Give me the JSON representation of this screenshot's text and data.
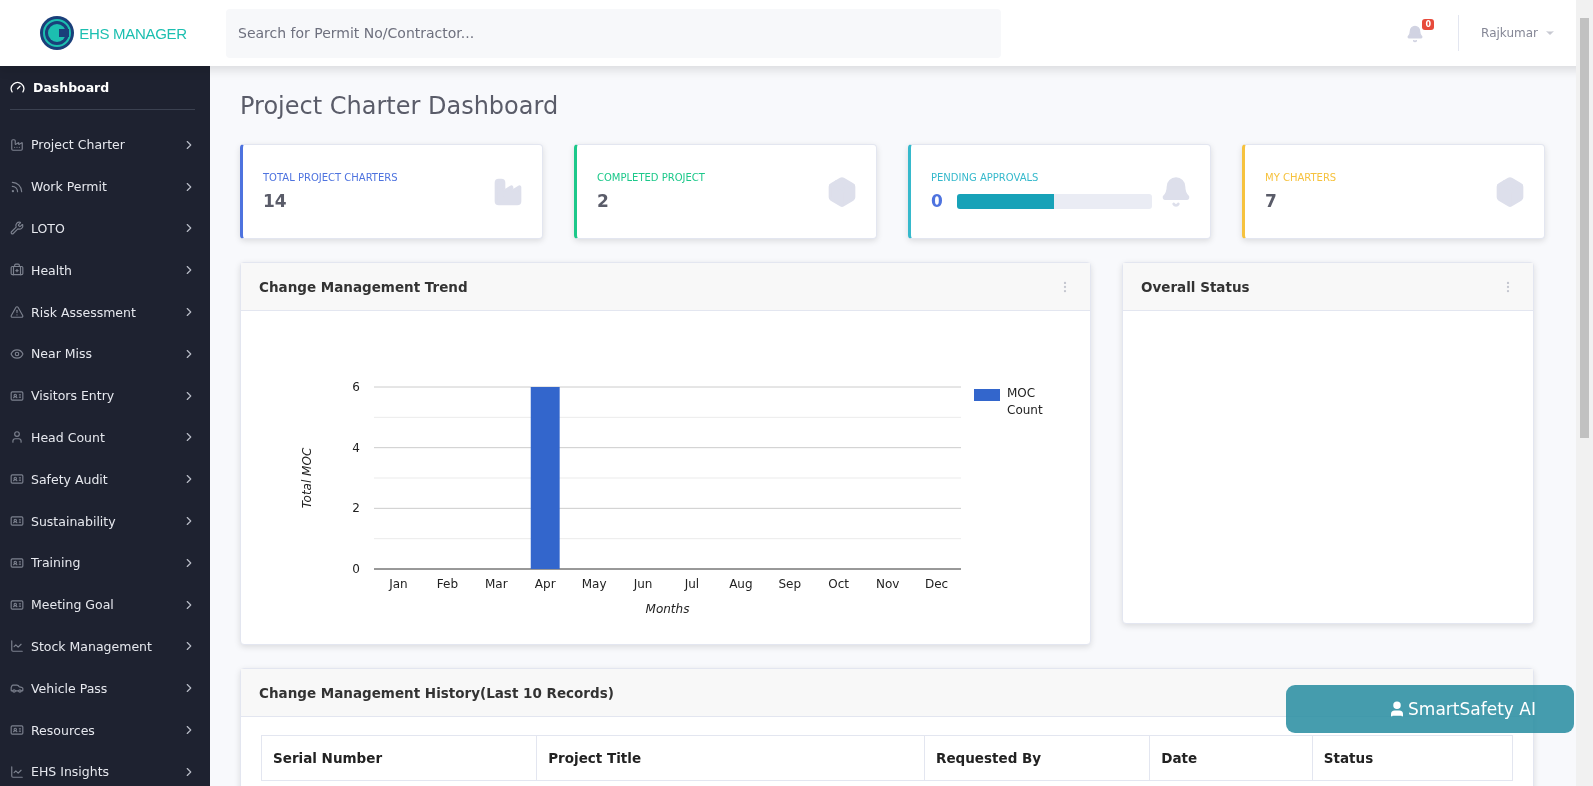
{
  "brand": {
    "name": "EHS MANAGER"
  },
  "search": {
    "placeholder": "Search for Permit No/Contractor..."
  },
  "notifications": {
    "count": "0"
  },
  "user": {
    "name": "Rajkumar"
  },
  "sidebar": {
    "header": {
      "label": "Dashboard",
      "selected": true
    },
    "items": [
      {
        "label": "Project Charter",
        "selected": false
      },
      {
        "label": "Work Permit",
        "selected": false
      },
      {
        "label": "LOTO",
        "selected": false
      },
      {
        "label": "Health",
        "selected": false
      },
      {
        "label": "Risk Assessment",
        "selected": false
      },
      {
        "label": "Near Miss",
        "selected": false
      },
      {
        "label": "Visitors Entry",
        "selected": false
      },
      {
        "label": "Head Count",
        "selected": false
      },
      {
        "label": "Safety Audit",
        "selected": false
      },
      {
        "label": "Sustainability",
        "selected": false
      },
      {
        "label": "Training",
        "selected": false
      },
      {
        "label": "Meeting Goal",
        "selected": false
      },
      {
        "label": "Stock Management",
        "selected": false
      },
      {
        "label": "Vehicle Pass",
        "selected": false
      },
      {
        "label": "Resources",
        "selected": false
      },
      {
        "label": "EHS Insights",
        "selected": false
      }
    ]
  },
  "page_title": "Project Charter Dashboard",
  "stat_cards": [
    {
      "label": "TOTAL PROJECT CHARTERS",
      "value": "14",
      "color": "#4e73df",
      "kind": "plain"
    },
    {
      "label": "COMPLETED PROJECT",
      "value": "2",
      "color": "#1cc88a",
      "kind": "plain"
    },
    {
      "label": "PENDING APPROVALS",
      "value": "0",
      "color": "#36b9cc",
      "kind": "progress",
      "level": 0.5
    },
    {
      "label": "MY CHARTERS",
      "value": "7",
      "color": "#f6c23e",
      "kind": "plain"
    }
  ],
  "trend_panel": {
    "title": "Change Management Trend",
    "chart_data": {
      "type": "bar",
      "xlabel": "Months",
      "ylabel": "Total MOC",
      "categories": [
        "Jan",
        "Feb",
        "Mar",
        "Apr",
        "May",
        "Jun",
        "Jul",
        "Aug",
        "Sep",
        "Oct",
        "Nov",
        "Dec"
      ],
      "series": [
        {
          "name": "MOC Count",
          "color": "#3366cc",
          "values": [
            0,
            0,
            0,
            6,
            0,
            0,
            0,
            0,
            0,
            0,
            0,
            0
          ]
        }
      ],
      "ylim": [
        0,
        6
      ],
      "yticks": [
        0,
        2,
        4,
        6
      ]
    }
  },
  "status_panel": {
    "title": "Overall Status"
  },
  "history_panel": {
    "title": "Change Management History(Last 10 Records)",
    "columns": [
      "Serial Number",
      "Project Title",
      "Requested By",
      "Date",
      "Status"
    ]
  },
  "assistant_button": {
    "label": "SmartSafety AI"
  }
}
